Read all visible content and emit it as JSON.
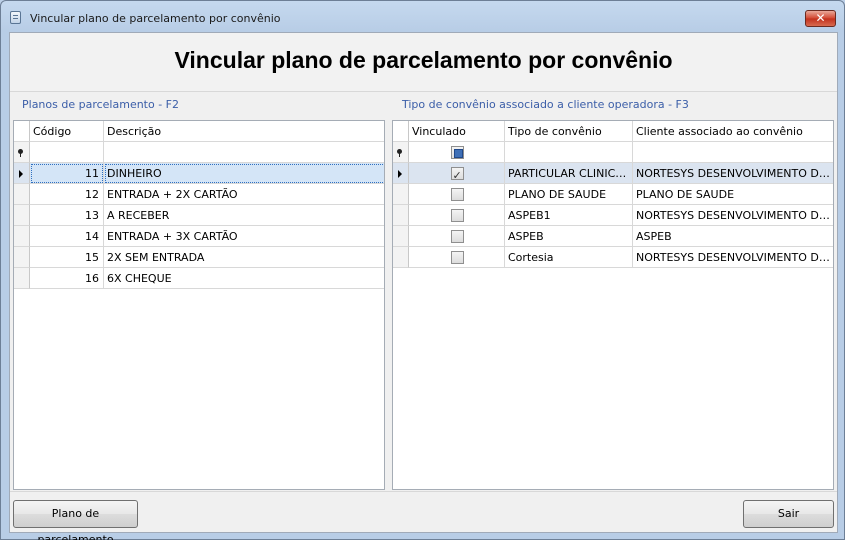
{
  "window": {
    "title": "Vincular plano de parcelamento por convênio",
    "close_glyph": "✕"
  },
  "page_title": "Vincular plano de parcelamento por convênio",
  "left_panel": {
    "caption": "Planos de parcelamento - F2",
    "columns": [
      "Código",
      "Descrição"
    ],
    "rows": [
      {
        "code": "11",
        "description": "DINHEIRO",
        "selected": true
      },
      {
        "code": "12",
        "description": "ENTRADA + 2X CARTÃO"
      },
      {
        "code": "13",
        "description": "A RECEBER"
      },
      {
        "code": "14",
        "description": "ENTRADA + 3X CARTÃO"
      },
      {
        "code": "15",
        "description": "2X SEM ENTRADA"
      },
      {
        "code": "16",
        "description": "6X CHEQUE"
      }
    ]
  },
  "right_panel": {
    "caption": "Tipo de convênio associado a cliente operadora - F3",
    "columns": [
      "Vinculado",
      "Tipo de convênio",
      "Cliente associado ao convênio"
    ],
    "rows": [
      {
        "linked": true,
        "type": "PARTICULAR CLINICA ...",
        "client": "NORTESYS DESENVOLVIMENTO DE SI...",
        "selected": true
      },
      {
        "linked": false,
        "type": "PLANO DE SAUDE",
        "client": "PLANO DE SAUDE"
      },
      {
        "linked": false,
        "type": "ASPEB1",
        "client": "NORTESYS DESENVOLVIMENTO DE SI..."
      },
      {
        "linked": false,
        "type": "ASPEB",
        "client": "ASPEB"
      },
      {
        "linked": false,
        "type": "Cortesia",
        "client": "NORTESYS DESENVOLVIMENTO DE SI..."
      }
    ]
  },
  "footer": {
    "left_button": "Plano de parcelamento",
    "right_button": "Sair"
  },
  "colors": {
    "caption": "#3b5ea8",
    "selected_row": "#dbe4f0",
    "close_button": "#d2452f"
  },
  "icons": {
    "app": "app-document-icon",
    "close": "close-icon",
    "filter": "filter-pin-icon",
    "row_pointer": "row-pointer-icon"
  }
}
